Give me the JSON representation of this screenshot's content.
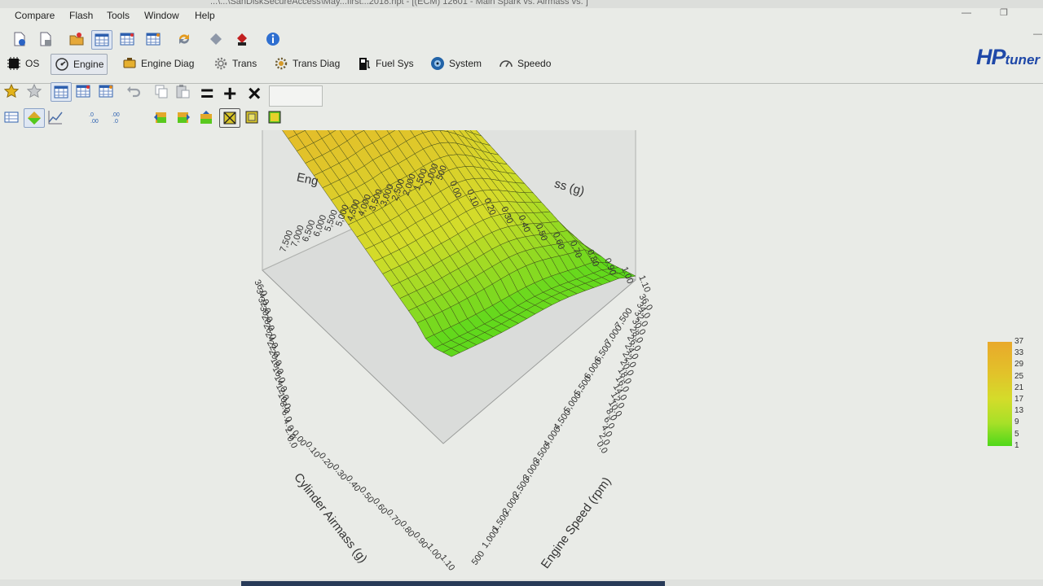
{
  "window": {
    "title": "...\\...\\SanDiskSecureAccess\\May...first...2018.hpt - [(ECM) 12601 - Main Spark vs. Airmass vs. ]"
  },
  "menu": [
    "Compare",
    "Flash",
    "Tools",
    "Window",
    "Help"
  ],
  "modules": [
    {
      "label": "OS",
      "icon": "chip-icon"
    },
    {
      "label": "Engine",
      "icon": "engine-icon",
      "active": true
    },
    {
      "label": "Engine Diag",
      "icon": "engine-diag-icon"
    },
    {
      "label": "Trans",
      "icon": "gear-icon"
    },
    {
      "label": "Trans Diag",
      "icon": "trans-diag-icon"
    },
    {
      "label": "Fuel Sys",
      "icon": "fuel-pump-icon"
    },
    {
      "label": "System",
      "icon": "system-icon"
    },
    {
      "label": "Speedo",
      "icon": "speedometer-icon"
    }
  ],
  "brand": {
    "prefix": "HP",
    "suffix": "tuner"
  },
  "table_tools": {
    "value_input": ""
  },
  "chart_data": {
    "type": "surface",
    "x_axis": {
      "title": "Cylinder Airmass (g)",
      "ticks": [
        "0.00",
        "0.10",
        "0.20",
        "0.30",
        "0.40",
        "0.50",
        "0.60",
        "0.70",
        "0.80",
        "0.90",
        "1.00",
        "1.10"
      ]
    },
    "y_axis": {
      "title": "Engine Speed (rpm)",
      "ticks": [
        "500",
        "1,000",
        "1,500",
        "2,000",
        "2,500",
        "3,000",
        "3,500",
        "4,000",
        "4,500",
        "5,000",
        "5,500",
        "6,000",
        "6,500",
        "7,000",
        "7,500"
      ]
    },
    "z_axis": {
      "ticks": [
        "0.0",
        "2.0",
        "4.0",
        "6.0",
        "8.0",
        "10.0",
        "12.0",
        "14.0",
        "16.0",
        "18.0",
        "20.0",
        "22.0",
        "24.0",
        "26.0",
        "28.0",
        "30.0",
        "32.0",
        "34.0",
        "36.0"
      ]
    },
    "legend": {
      "ticks": [
        "37",
        "33",
        "29",
        "25",
        "21",
        "17",
        "13",
        "9",
        "5",
        "1"
      ],
      "colors": [
        "#e9a92b",
        "#e4b82a",
        "#e0c62a",
        "#d8d62a",
        "#c6dd2a",
        "#aee028",
        "#8edd22",
        "#6ed91c",
        "#55d81a",
        "#4ed81a"
      ]
    },
    "colorscale": [
      "#4fd81a",
      "#d4dc2a",
      "#e2c22a",
      "#e9a92b"
    ]
  }
}
